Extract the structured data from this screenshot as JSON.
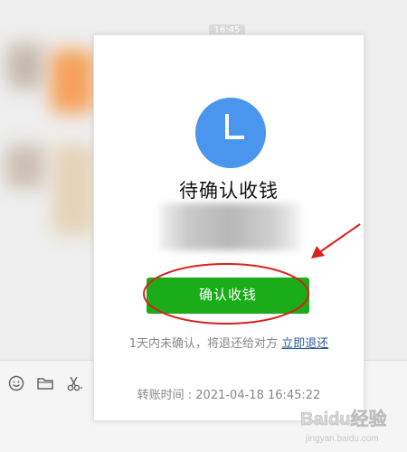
{
  "background": {
    "timestamp": "16:45"
  },
  "dialog": {
    "title": "待确认收钱",
    "confirm_button_label": "确认收钱",
    "hint_text": "1天内未确认，将退还给对方",
    "refund_link_label": "立即退还",
    "transfer_time_label": "转账时间 : 2021-04-18 16:45:22"
  },
  "colors": {
    "clock_blue": "#4a96ee",
    "button_green": "#1aad19",
    "annotation_red": "#d9221e",
    "link_blue": "#2a5d9a"
  },
  "icons": {
    "toolbar": [
      "emoji-icon",
      "folder-icon",
      "scissors-icon"
    ],
    "dialog": "clock-icon"
  },
  "watermark": {
    "text": "Baidu经验",
    "subtext": "jingyan.baidu.com"
  }
}
